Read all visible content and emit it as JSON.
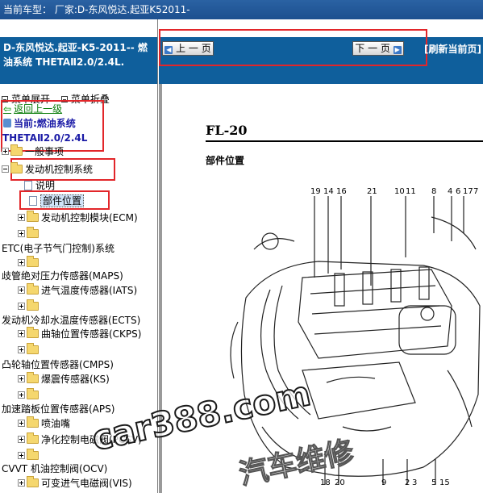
{
  "window": {
    "title": "当前车型：  厂家:D-东风悦达.起亚K52011-"
  },
  "left_panel": {
    "header_line1": "D-东风悦达.起亚-K5-2011-- 燃",
    "header_line2": "油系统 THETAⅡ2.0/2.4L.",
    "expand_label": "菜单展开",
    "collapse_label": "菜单折叠",
    "back_label": "返回上一级",
    "current_label": "当前:燃油系统",
    "current_sub": "THETAⅡ2.0/2.4L",
    "tree": [
      {
        "label": "一般事项"
      },
      {
        "label": "发动机控制系统"
      },
      {
        "label": "说明"
      },
      {
        "label": "部件位置"
      },
      {
        "label": "发动机控制模块(ECM)"
      },
      {
        "label": "ETC(电子节气门控制)系统"
      },
      {
        "label": "歧管绝对压力传感器(MAPS)"
      },
      {
        "label": "进气温度传感器(IATS)"
      },
      {
        "label": "发动机冷却水温度传感器(ECTS)"
      },
      {
        "label": "曲轴位置传感器(CKPS)"
      },
      {
        "label": "凸轮轴位置传感器(CMPS)"
      },
      {
        "label": "爆震传感器(KS)"
      },
      {
        "label": "加速踏板位置传感器(APS)"
      },
      {
        "label": "喷油嘴"
      },
      {
        "label": "净化控制电磁阀(PCSV)"
      },
      {
        "label": "CVVT 机油控制阀(OCV)"
      },
      {
        "label": "可变进气电磁阀(VIS)"
      }
    ]
  },
  "right_panel": {
    "prev_label": "上 一 页",
    "next_label": "下 一 页",
    "refresh_label": "[刷新当前页]",
    "page_code": "FL-20",
    "section_title": "部件位置",
    "callouts_top": [
      "19",
      "14",
      "16",
      "21",
      "10",
      "11",
      "8",
      "4",
      "6",
      "17",
      "7"
    ],
    "callouts_bottom": [
      "18",
      "20",
      "9",
      "2",
      "3",
      "5",
      "15"
    ],
    "watermark": "car388.com",
    "watermark2": "汽车维修"
  },
  "colors": {
    "header_blue": "#0f5f9c",
    "highlight_red": "#e2262a",
    "back_green": "#0a7d0a",
    "current_blue": "#1a1aa6"
  }
}
